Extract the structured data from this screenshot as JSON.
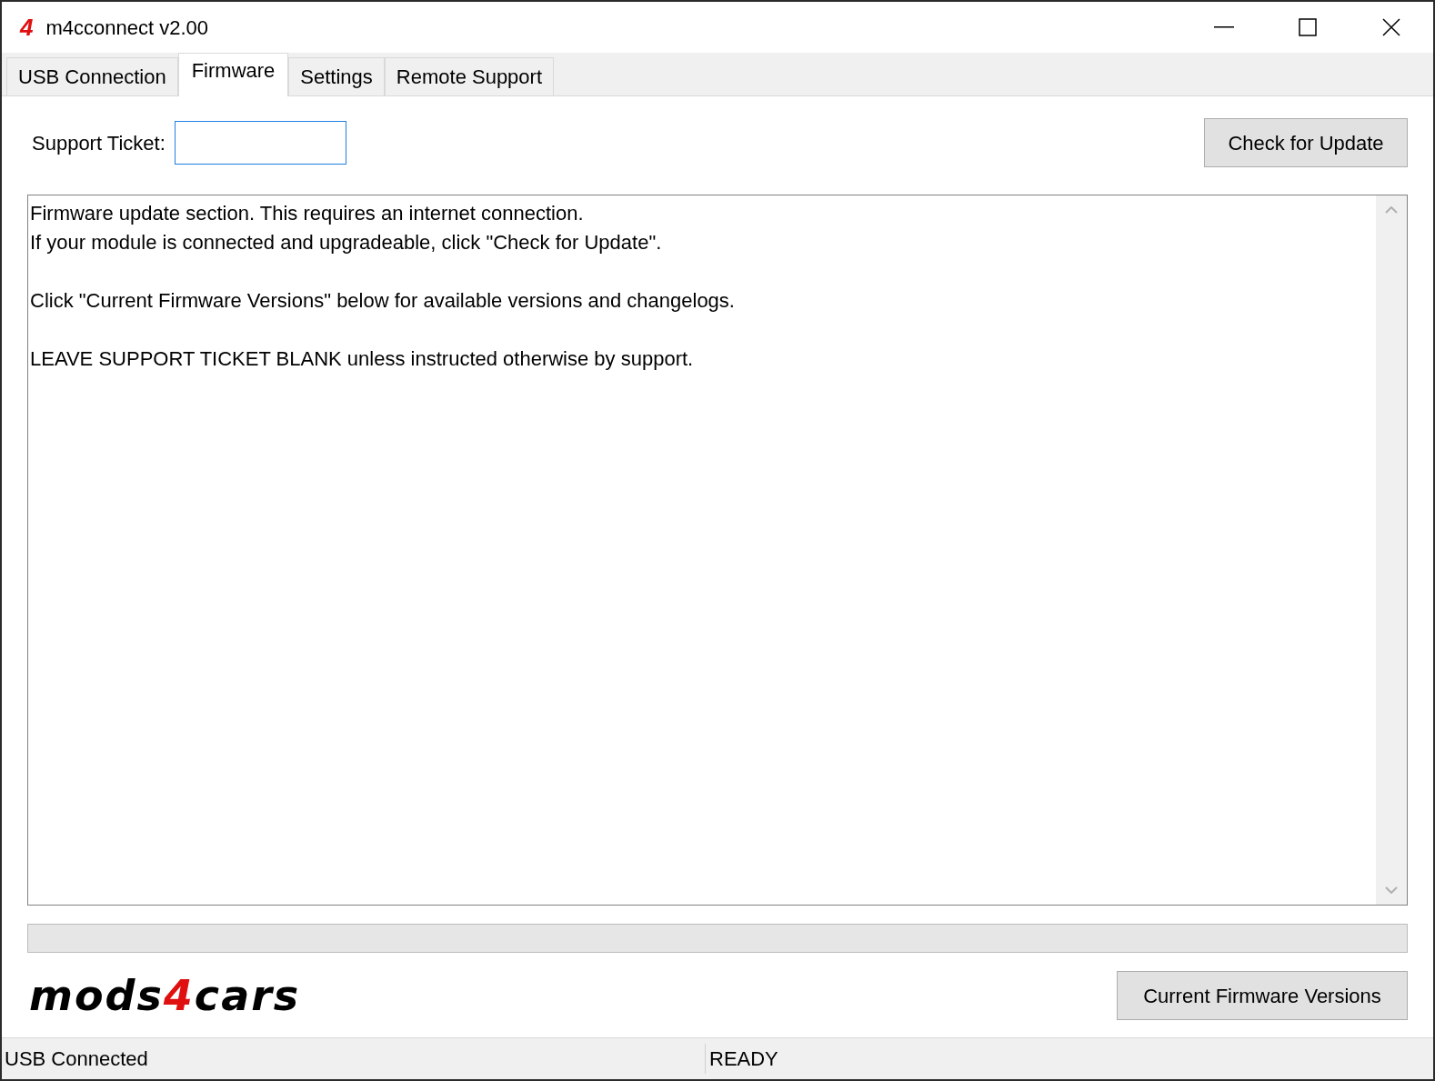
{
  "window": {
    "icon_glyph": "4",
    "title": "m4cconnect v2.00"
  },
  "tabs": [
    {
      "label": "USB Connection",
      "selected": false
    },
    {
      "label": "Firmware",
      "selected": true
    },
    {
      "label": "Settings",
      "selected": false
    },
    {
      "label": "Remote Support",
      "selected": false
    }
  ],
  "support_ticket": {
    "label": "Support Ticket:"
  },
  "check_button": "Check for Update",
  "output_paragraphs": [
    [
      "Firmware update section. This requires an internet connection.",
      "If your module is connected and upgradeable, click \"Check for Update\"."
    ],
    [
      "Click \"Current Firmware Versions\" below for available versions and changelogs."
    ],
    [
      "LEAVE SUPPORT TICKET BLANK unless instructed otherwise by support."
    ]
  ],
  "progress": {
    "level": 0
  },
  "logo": {
    "before": "mods",
    "accent": "4",
    "after": "cars"
  },
  "versions_button": "Current Firmware Versions",
  "status_bar": [
    "USB Connected",
    "READY"
  ]
}
